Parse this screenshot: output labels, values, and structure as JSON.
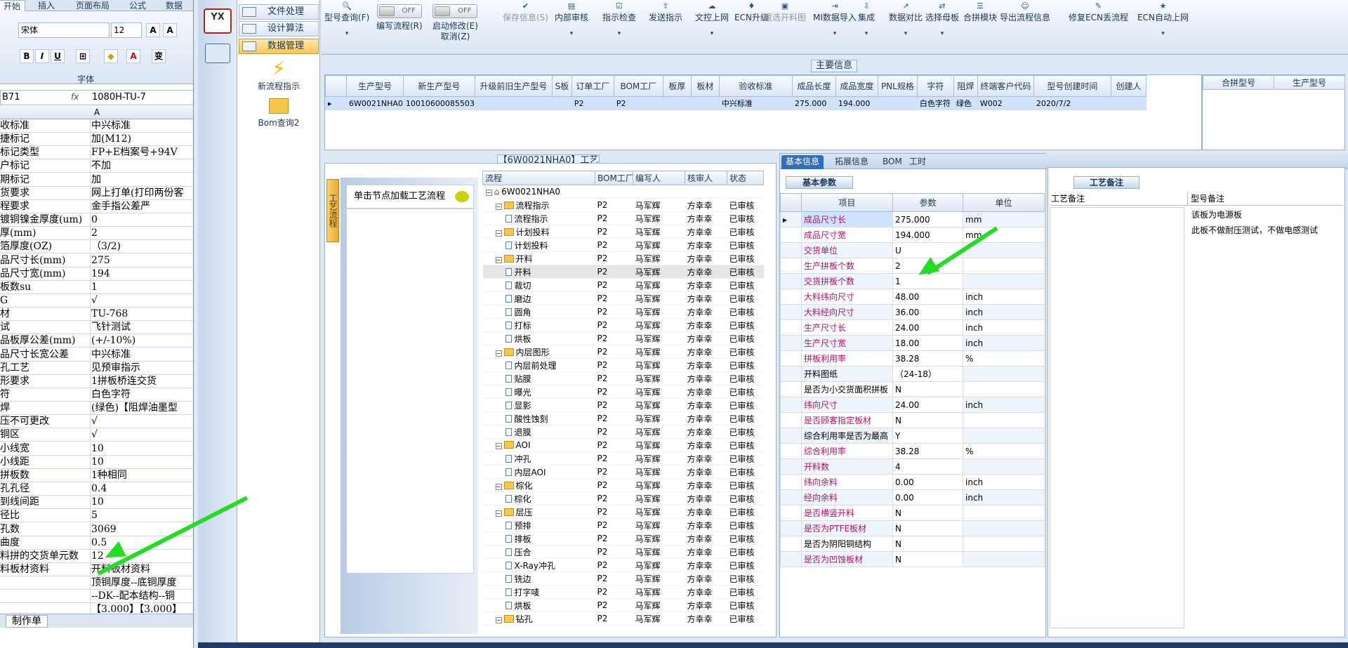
{
  "excel": {
    "tabs": [
      "开始",
      "插入",
      "页面布局",
      "公式",
      "数据"
    ],
    "font_name": "宋体",
    "font_size": "12",
    "ribbon_group": "字体",
    "name_box": "B71",
    "formula_value": "1080H-TU-7",
    "column_header": "A",
    "sheet_tab": "制作单",
    "rows": [
      [
        "收标准",
        "中兴标准"
      ],
      [
        "捷标记",
        "加(M12)"
      ],
      [
        "标记类型",
        "FP+E档案号+94V"
      ],
      [
        "户标记",
        "不加"
      ],
      [
        "期标记",
        "加"
      ],
      [
        "货要求",
        "网上打单(打印两份客"
      ],
      [
        "程要求",
        "金手指公差严"
      ],
      [
        "镀铜镍金厚度(um)",
        "0"
      ],
      [
        "厚(mm)",
        "2"
      ],
      [
        "箔厚度(OZ)",
        "（3/2)"
      ],
      [
        "品尺寸长(mm)",
        "275"
      ],
      [
        "品尺寸宽(mm)",
        "194"
      ],
      [
        "板数su",
        "1"
      ],
      [
        "G",
        "√"
      ],
      [
        "材",
        "TU-768"
      ],
      [
        "试",
        "飞针测试"
      ],
      [
        "品板厚公差(mm)",
        "(+/-10%)"
      ],
      [
        "品尺寸长宽公差",
        "中兴标准"
      ],
      [
        "孔工艺",
        "见预审指示"
      ],
      [
        "形要求",
        "1拼板桥连交货"
      ],
      [
        "符",
        "白色字符"
      ],
      [
        "焊",
        "(绿色)【阻焊油墨型"
      ],
      [
        "压不可更改",
        "√"
      ],
      [
        "铜区",
        "√"
      ],
      [
        "小线宽",
        "10"
      ],
      [
        "小线距",
        "10"
      ],
      [
        "拼板数",
        "1种相同"
      ],
      [
        "孔孔径",
        "0.4"
      ],
      [
        "到线间距",
        "10"
      ],
      [
        "径比",
        "5"
      ],
      [
        "孔数",
        "3069"
      ],
      [
        "曲度",
        "0.5"
      ],
      [
        "料拼的交货单元数",
        "12"
      ],
      [
        "料板材资料",
        "开料板材资料"
      ],
      [
        "",
        "顶铜厚度--底铜厚度"
      ],
      [
        "",
        "--DK--配本结构--铜"
      ],
      [
        "",
        "【3.000】【3.000】"
      ]
    ]
  },
  "app": {
    "logo_text": "YX",
    "nav": {
      "items": [
        "文件处理",
        "设计算法",
        "数据管理"
      ],
      "tools": [
        "新流程指示",
        "Bom查询2"
      ]
    },
    "toolbar": [
      {
        "label": "型号查询(F)",
        "icon": "search-icon",
        "dd": true
      },
      {
        "label": "编写流程(R)",
        "toggle": "OFF"
      },
      {
        "label": "启动修改(E)\n取消(Z)",
        "toggle": "OFF"
      },
      {
        "label": "保存信息(S)",
        "icon": "check-icon",
        "disabled": true
      },
      {
        "label": "内部审核",
        "icon": "folder-icon",
        "dd": true
      },
      {
        "label": "指示检查",
        "icon": "checklist-icon",
        "dd": true
      },
      {
        "label": "发送指示",
        "icon": "upload-icon"
      },
      {
        "label": "文控上网",
        "icon": "cloud-icon",
        "dd": true
      },
      {
        "label": "ECN升级",
        "icon": "ecn-icon"
      },
      {
        "label": "重选开料图",
        "icon": "image-icon",
        "disabled": true
      },
      {
        "label": "MI数据导入",
        "icon": "import-icon",
        "dd": true
      },
      {
        "label": "集成",
        "icon": "download-icon",
        "dd": true
      },
      {
        "label": "数据对比",
        "icon": "compare-icon",
        "dd": true
      },
      {
        "label": "选择母板",
        "icon": "shuffle-icon",
        "dd": true
      },
      {
        "label": "合拼模块",
        "icon": "list-icon"
      },
      {
        "label": "导出流程信息",
        "icon": "smile-icon"
      },
      {
        "label": "修复ECN丢流程",
        "icon": "wrench-icon"
      },
      {
        "label": "ECN自动上网",
        "icon": "star-icon",
        "dd": true
      }
    ],
    "main_info": {
      "title": "主要信息",
      "headers": [
        "生产型号",
        "新生产型号",
        "升级前旧生产型号",
        "S板",
        "订单工厂",
        "BOM工厂",
        "板厚",
        "板材",
        "验收标准",
        "成品长度",
        "成品宽度",
        "PNL规格",
        "字符",
        "阻焊",
        "终端客户代码",
        "型号创建时间",
        "创建人"
      ],
      "row": [
        "6W0021NHA0",
        "10010600085503",
        "",
        "",
        "P2",
        "P2",
        "",
        "",
        "中兴标准",
        "275.000",
        "194.000",
        "",
        "白色字符",
        "绿色",
        "W002",
        "2020/7/2",
        ""
      ]
    },
    "merge_headers": [
      "合拼型号",
      "生产型号"
    ],
    "process": {
      "title": "【6W0021NHA0】工艺流程",
      "vert_tab": "工艺流程",
      "hint": "单击节点加载工艺流程",
      "headers": [
        "流程",
        "BOM工厂",
        "编写人",
        "核审人",
        "状态"
      ],
      "rows": [
        {
          "lvl": 0,
          "name": "6W0021NHA0",
          "bom": "",
          "w": "",
          "r": "",
          "s": "",
          "t": "root"
        },
        {
          "lvl": 1,
          "name": "流程指示",
          "bom": "P2",
          "w": "马军辉",
          "r": "方幸幸",
          "s": "已审核",
          "t": "f"
        },
        {
          "lvl": 2,
          "name": "流程指示",
          "bom": "P2",
          "w": "马军辉",
          "r": "方幸幸",
          "s": "已审核",
          "t": "d"
        },
        {
          "lvl": 1,
          "name": "计划投料",
          "bom": "P2",
          "w": "马军辉",
          "r": "方幸幸",
          "s": "已审核",
          "t": "f"
        },
        {
          "lvl": 2,
          "name": "计划投料",
          "bom": "P2",
          "w": "马军辉",
          "r": "方幸幸",
          "s": "已审核",
          "t": "d"
        },
        {
          "lvl": 1,
          "name": "开料",
          "bom": "P2",
          "w": "马军辉",
          "r": "方幸幸",
          "s": "已审核",
          "t": "f"
        },
        {
          "lvl": 2,
          "name": "开料",
          "bom": "P2",
          "w": "马军辉",
          "r": "方幸幸",
          "s": "已审核",
          "t": "d",
          "sel": true
        },
        {
          "lvl": 2,
          "name": "裁切",
          "bom": "P2",
          "w": "马军辉",
          "r": "方幸幸",
          "s": "已审核",
          "t": "d"
        },
        {
          "lvl": 2,
          "name": "磨边",
          "bom": "P2",
          "w": "马军辉",
          "r": "方幸幸",
          "s": "已审核",
          "t": "d"
        },
        {
          "lvl": 2,
          "name": "圆角",
          "bom": "P2",
          "w": "马军辉",
          "r": "方幸幸",
          "s": "已审核",
          "t": "d"
        },
        {
          "lvl": 2,
          "name": "打标",
          "bom": "P2",
          "w": "马军辉",
          "r": "方幸幸",
          "s": "已审核",
          "t": "d"
        },
        {
          "lvl": 2,
          "name": "烘板",
          "bom": "P2",
          "w": "马军辉",
          "r": "方幸幸",
          "s": "已审核",
          "t": "d"
        },
        {
          "lvl": 1,
          "name": "内层图形",
          "bom": "P2",
          "w": "马军辉",
          "r": "方幸幸",
          "s": "已审核",
          "t": "f"
        },
        {
          "lvl": 2,
          "name": "内层前处理",
          "bom": "P2",
          "w": "马军辉",
          "r": "方幸幸",
          "s": "已审核",
          "t": "d"
        },
        {
          "lvl": 2,
          "name": "贴膜",
          "bom": "P2",
          "w": "马军辉",
          "r": "方幸幸",
          "s": "已审核",
          "t": "d"
        },
        {
          "lvl": 2,
          "name": "曝光",
          "bom": "P2",
          "w": "马军辉",
          "r": "方幸幸",
          "s": "已审核",
          "t": "d"
        },
        {
          "lvl": 2,
          "name": "显影",
          "bom": "P2",
          "w": "马军辉",
          "r": "方幸幸",
          "s": "已审核",
          "t": "d"
        },
        {
          "lvl": 2,
          "name": "酸性蚀刻",
          "bom": "P2",
          "w": "马军辉",
          "r": "方幸幸",
          "s": "已审核",
          "t": "d"
        },
        {
          "lvl": 2,
          "name": "退膜",
          "bom": "P2",
          "w": "马军辉",
          "r": "方幸幸",
          "s": "已审核",
          "t": "d"
        },
        {
          "lvl": 1,
          "name": "AOI",
          "bom": "P2",
          "w": "马军辉",
          "r": "方幸幸",
          "s": "已审核",
          "t": "f"
        },
        {
          "lvl": 2,
          "name": "冲孔",
          "bom": "P2",
          "w": "马军辉",
          "r": "方幸幸",
          "s": "已审核",
          "t": "d"
        },
        {
          "lvl": 2,
          "name": "内层AOI",
          "bom": "P2",
          "w": "马军辉",
          "r": "方幸幸",
          "s": "已审核",
          "t": "d"
        },
        {
          "lvl": 1,
          "name": "棕化",
          "bom": "P2",
          "w": "马军辉",
          "r": "方幸幸",
          "s": "已审核",
          "t": "f"
        },
        {
          "lvl": 2,
          "name": "棕化",
          "bom": "P2",
          "w": "马军辉",
          "r": "方幸幸",
          "s": "已审核",
          "t": "d"
        },
        {
          "lvl": 1,
          "name": "层压",
          "bom": "P2",
          "w": "马军辉",
          "r": "方幸幸",
          "s": "已审核",
          "t": "f"
        },
        {
          "lvl": 2,
          "name": "预排",
          "bom": "P2",
          "w": "马军辉",
          "r": "方幸幸",
          "s": "已审核",
          "t": "d"
        },
        {
          "lvl": 2,
          "name": "排板",
          "bom": "P2",
          "w": "马军辉",
          "r": "方幸幸",
          "s": "已审核",
          "t": "d"
        },
        {
          "lvl": 2,
          "name": "压合",
          "bom": "P2",
          "w": "马军辉",
          "r": "方幸幸",
          "s": "已审核",
          "t": "d"
        },
        {
          "lvl": 2,
          "name": "X-Ray冲孔",
          "bom": "P2",
          "w": "马军辉",
          "r": "方幸幸",
          "s": "已审核",
          "t": "d"
        },
        {
          "lvl": 2,
          "name": "铣边",
          "bom": "P2",
          "w": "马军辉",
          "r": "方幸幸",
          "s": "已审核",
          "t": "d"
        },
        {
          "lvl": 2,
          "name": "打字唛",
          "bom": "P2",
          "w": "马军辉",
          "r": "方幸幸",
          "s": "已审核",
          "t": "d"
        },
        {
          "lvl": 2,
          "name": "烘板",
          "bom": "P2",
          "w": "马军辉",
          "r": "方幸幸",
          "s": "已审核",
          "t": "d"
        },
        {
          "lvl": 1,
          "name": "钻孔",
          "bom": "P2",
          "w": "马军辉",
          "r": "方幸幸",
          "s": "已审核",
          "t": "f"
        }
      ]
    },
    "basic": {
      "tabs": [
        "基本信息",
        "拓展信息",
        "BOM",
        "工时"
      ],
      "title": "基本参数",
      "headers": [
        "项目",
        "参数",
        "单位"
      ],
      "rows": [
        [
          "成品尺寸长",
          "275.000",
          "mm",
          1
        ],
        [
          "成品尺寸宽",
          "194.000",
          "mm",
          1
        ],
        [
          "交货单位",
          "U",
          "",
          1
        ],
        [
          "生产拼板个数",
          "2",
          "",
          1
        ],
        [
          "交货拼板个数",
          "1",
          "",
          1
        ],
        [
          "大料纬向尺寸",
          "48.00",
          "inch",
          1
        ],
        [
          "大料经向尺寸",
          "36.00",
          "inch",
          1
        ],
        [
          "生产尺寸长",
          "24.00",
          "inch",
          1
        ],
        [
          "生产尺寸宽",
          "18.00",
          "inch",
          1
        ],
        [
          "拼板利用率",
          "38.28",
          "%",
          1
        ],
        [
          "开料图纸",
          "（24-18）",
          "",
          0
        ],
        [
          "是否为小交货面积拼板",
          "N",
          "",
          0
        ],
        [
          "纬向尺寸",
          "24.00",
          "inch",
          1
        ],
        [
          "是否顾客指定板材",
          "N",
          "",
          1
        ],
        [
          "综合利用率是否为最高",
          "Y",
          "",
          0
        ],
        [
          "综合利用率",
          "38.28",
          "%",
          1
        ],
        [
          "开料数",
          "4",
          "",
          1
        ],
        [
          "纬向余料",
          "0.00",
          "inch",
          1
        ],
        [
          "经向余料",
          "0.00",
          "inch",
          1
        ],
        [
          "是否横竖开料",
          "N",
          "",
          1
        ],
        [
          "是否为PTFE板材",
          "N",
          "",
          1
        ],
        [
          "是否为阴阳铜结构",
          "N",
          "",
          0
        ],
        [
          "是否为凹蚀板材",
          "N",
          "",
          1
        ]
      ]
    },
    "remarks": {
      "title": "工艺备注",
      "headers": [
        "工艺备注",
        "型号备注"
      ],
      "model_notes": [
        "该板为电源板",
        "此板不做耐压测试，不做电感测试"
      ]
    }
  }
}
